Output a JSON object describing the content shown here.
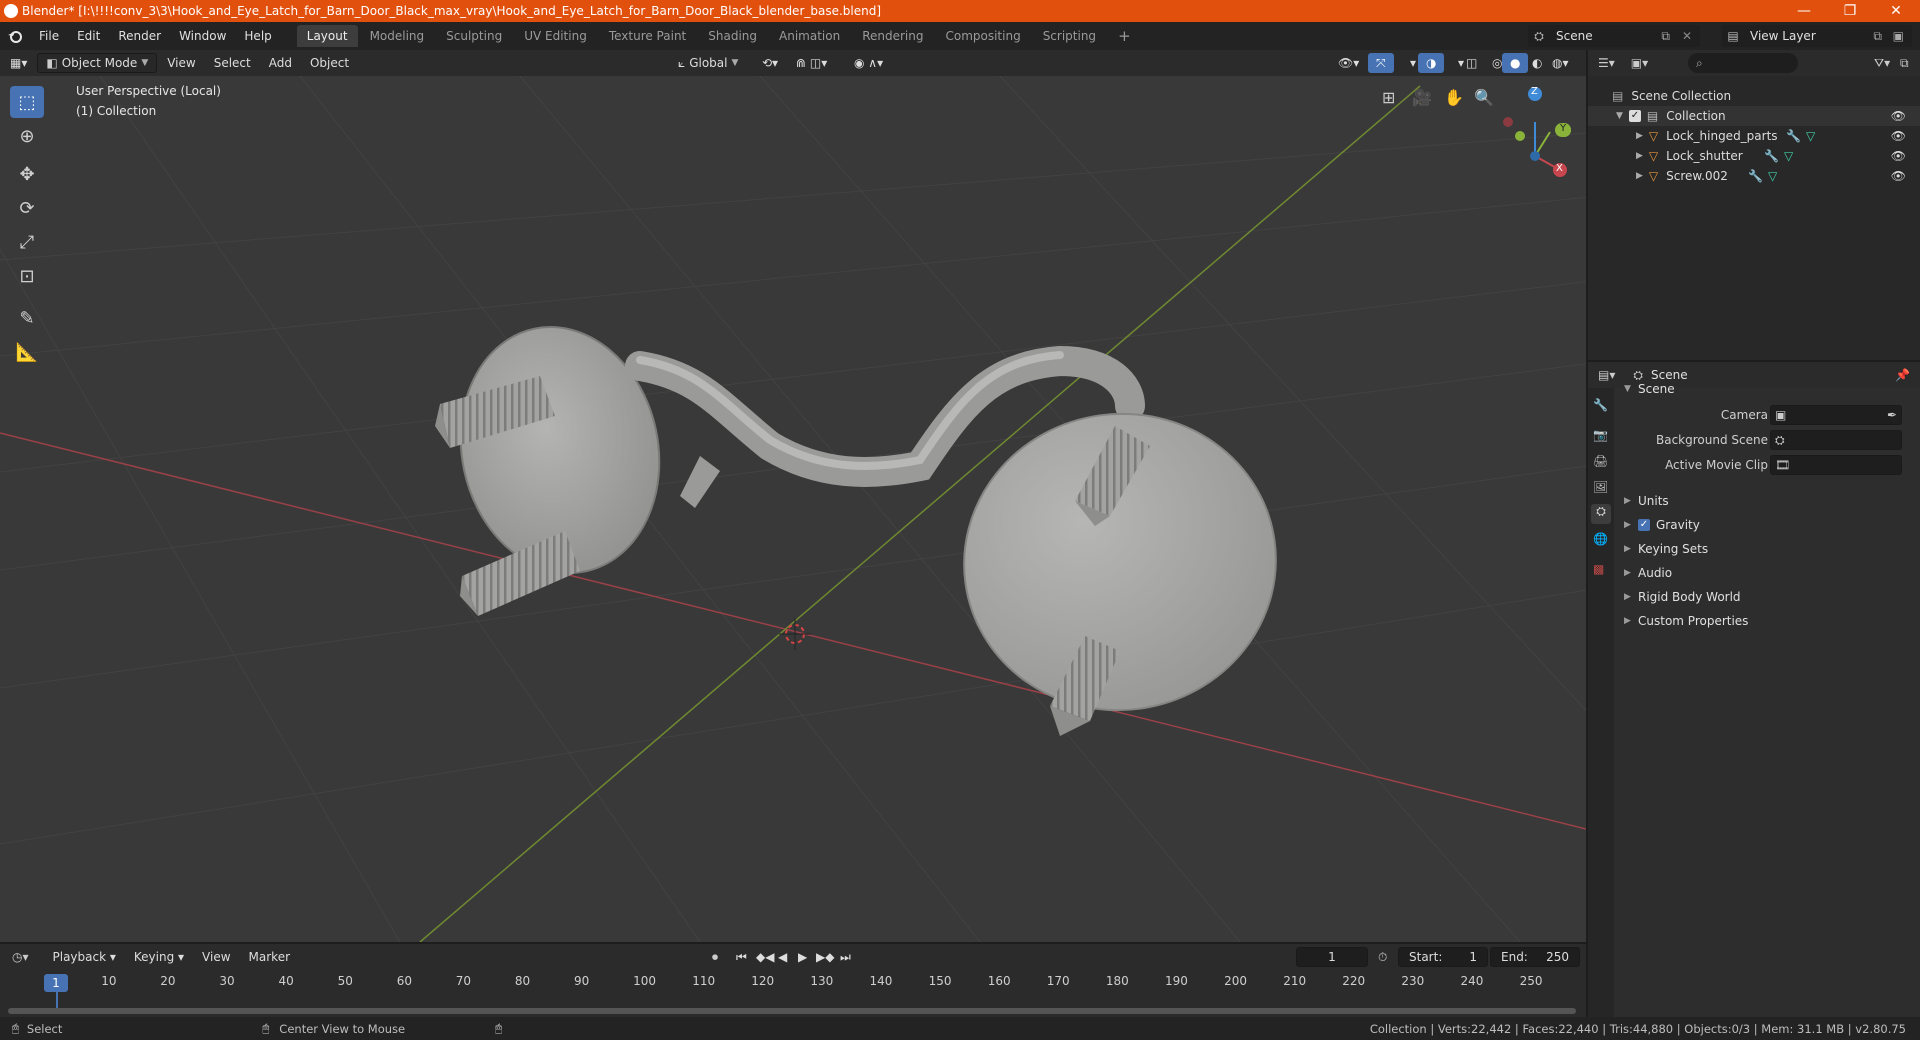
{
  "window": {
    "title": "Blender* [I:\\!!!!conv_3\\3\\Hook_and_Eye_Latch_for_Barn_Door_Black_max_vray\\Hook_and_Eye_Latch_for_Barn_Door_Black_blender_base.blend]",
    "minimize": "—",
    "maximize": "❐",
    "close": "✕"
  },
  "menu": {
    "items": [
      "File",
      "Edit",
      "Render",
      "Window",
      "Help"
    ],
    "workspaces": [
      "Layout",
      "Modeling",
      "Sculpting",
      "UV Editing",
      "Texture Paint",
      "Shading",
      "Animation",
      "Rendering",
      "Compositing",
      "Scripting"
    ],
    "add_tab": "+",
    "scene": "Scene",
    "view_layer": "View Layer"
  },
  "viewport_header": {
    "mode": "Object Mode",
    "menus": [
      "View",
      "Select",
      "Add",
      "Object"
    ],
    "orientation": "Global"
  },
  "viewport": {
    "perspective": "User Perspective (Local)",
    "collection": "(1) Collection",
    "gizmo": {
      "x": "X",
      "y": "Y",
      "z": "Z"
    }
  },
  "outliner": {
    "search_placeholder": "",
    "scene_collection": "Scene Collection",
    "collection": "Collection",
    "objects": [
      "Lock_hinged_parts",
      "Lock_shutter",
      "Screw.002"
    ]
  },
  "properties": {
    "context": "Scene",
    "panel": "Scene",
    "camera_label": "Camera",
    "background_scene_label": "Background Scene",
    "active_movie_clip_label": "Active Movie Clip",
    "sections": [
      "Units",
      "Gravity",
      "Keying Sets",
      "Audio",
      "Rigid Body World",
      "Custom Properties"
    ]
  },
  "timeline": {
    "menus": [
      "Playback",
      "Keying",
      "View",
      "Marker"
    ],
    "current_frame": "1",
    "start_label": "Start:",
    "start": "1",
    "end_label": "End:",
    "end": "250",
    "ruler": [
      "1",
      "10",
      "20",
      "30",
      "40",
      "50",
      "60",
      "70",
      "80",
      "90",
      "100",
      "110",
      "120",
      "130",
      "140",
      "150",
      "160",
      "170",
      "180",
      "190",
      "200",
      "210",
      "220",
      "230",
      "240",
      "250"
    ]
  },
  "status": {
    "select": "Select",
    "center_view": "Center View to Mouse",
    "stats": "Collection | Verts:22,442 | Faces:22,440 | Tris:44,880 | Objects:0/3 | Mem: 31.1 MB | v2.80.75"
  },
  "colors": {
    "accent": "#4772b3",
    "title_bar": "#e2500d",
    "x_axis": "#c8474e",
    "y_axis": "#8ab33a",
    "z_axis": "#3f8bd8",
    "mesh": "#a8a8a6"
  },
  "icons": [
    "blender-logo-icon",
    "editor-type-icon",
    "cursor-icon",
    "move-icon",
    "rotate-icon",
    "scale-icon",
    "transform-icon",
    "annotate-icon",
    "measure-icon",
    "grid-icon",
    "camera-icon",
    "hand-icon",
    "zoom-icon",
    "eye-icon",
    "mesh-icon",
    "wrench-icon",
    "filter-icon",
    "pin-icon",
    "play-icon",
    "record-icon"
  ]
}
